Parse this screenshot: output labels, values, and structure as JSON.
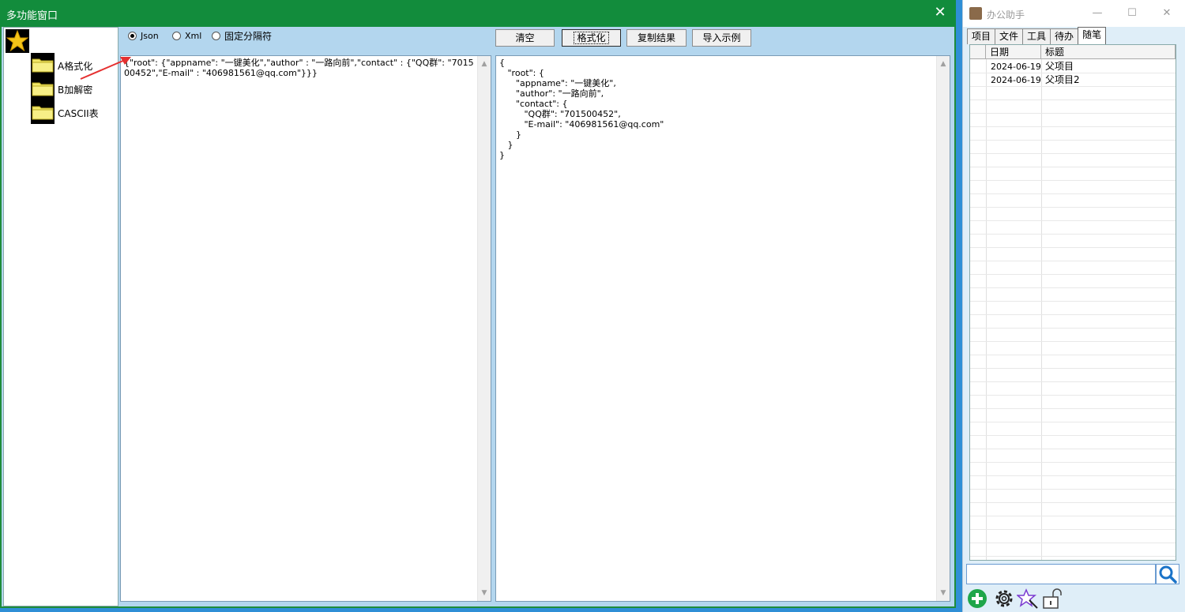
{
  "main_window": {
    "title": "多功能窗口",
    "close_glyph": "✕",
    "tree": {
      "root_icon": "star-icon",
      "items": [
        {
          "label": "A格式化",
          "icon": "folder-icon"
        },
        {
          "label": "B加解密",
          "icon": "folder-icon"
        },
        {
          "label": "CASCII表",
          "icon": "folder-icon"
        }
      ]
    },
    "format_options": [
      {
        "label": "Json",
        "checked": true
      },
      {
        "label": "Xml",
        "checked": false
      },
      {
        "label": "固定分隔符",
        "checked": false
      }
    ],
    "toolbar": {
      "clear": "清空",
      "format": "格式化",
      "copy": "复制结果",
      "import": "导入示例"
    },
    "input_text": "{\"root\": {\"appname\": \"一键美化\",\"author\" : \"一路向前\",\"contact\" : {\"QQ群\": \"701500452\",\"E-mail\" : \"406981561@qq.com\"}}}",
    "output_text": "{\n   \"root\": {\n      \"appname\": \"一键美化\",\n      \"author\": \"一路向前\",\n      \"contact\": {\n         \"QQ群\": \"701500452\",\n         \"E-mail\": \"406981561@qq.com\"\n      }\n   }\n}",
    "accent_colors": {
      "titlebar": "#128c3c",
      "client": "#b3d6ee",
      "annotation_arrow": "#e53030"
    }
  },
  "side_window": {
    "title": "办公助手",
    "controls": {
      "minimize": "—",
      "maximize": "☐",
      "close": "✕"
    },
    "tabs": [
      {
        "label": "项目",
        "active": false
      },
      {
        "label": "文件",
        "active": false
      },
      {
        "label": "工具",
        "active": false
      },
      {
        "label": "待办",
        "active": false
      },
      {
        "label": "随笔",
        "active": true
      }
    ],
    "columns": [
      "日期",
      "标题"
    ],
    "rows": [
      {
        "date": "2024-06-19",
        "title": "父项目"
      },
      {
        "date": "2024-06-19",
        "title": "父项目2"
      }
    ],
    "search": {
      "value": "",
      "icon": "search-icon"
    },
    "footer_icons": [
      "add-icon",
      "settings-icon",
      "magic-wand-icon",
      "unlock-icon"
    ]
  }
}
